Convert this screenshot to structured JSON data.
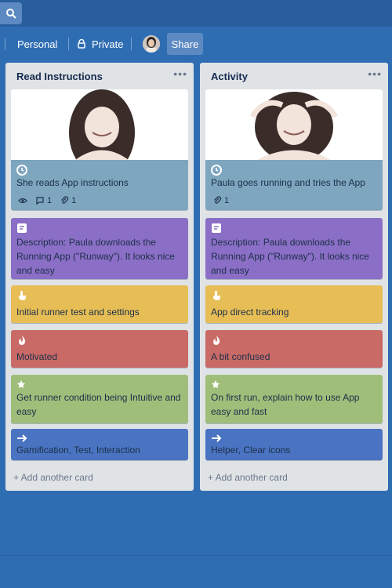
{
  "header": {
    "search_icon": "search-icon"
  },
  "board_bar": {
    "visibility_team_label": "Personal",
    "privacy_label": "Private",
    "share_label": "Share"
  },
  "colors": {
    "background": "#2f6db3",
    "card_blue_gray": "#7ea6bf",
    "card_purple": "#8b6fc7",
    "card_yellow": "#e7be55",
    "card_red": "#c96a66",
    "card_green": "#9fbe7a",
    "card_blue": "#4a74c2"
  },
  "lists": [
    {
      "title": "Read Instructions",
      "cards": [
        {
          "text": "She reads App instructions",
          "icon": "clock-icon",
          "badges": {
            "views": "",
            "comments": "1",
            "attachments": "1"
          }
        },
        {
          "text": "Description: Paula downloads the Running App (\"Runway\"). It looks nice and easy",
          "icon": "description-icon"
        },
        {
          "text": "Initial runner test and settings",
          "icon": "touch-icon"
        },
        {
          "text": "Motivated",
          "icon": "flame-icon"
        },
        {
          "text": "Get runner condition being Intuitive and easy",
          "icon": "star-icon"
        },
        {
          "text": "Gamification, Test, Interaction",
          "icon": "arrow-right-icon"
        }
      ],
      "add_card_label": "+ Add another card"
    },
    {
      "title": "Activity",
      "cards": [
        {
          "text": "Paula goes running and tries the App",
          "icon": "clock-icon",
          "badges": {
            "attachments": "1"
          }
        },
        {
          "text": "Description: Paula downloads the Running App (\"Runway\"). It looks nice and easy",
          "icon": "description-icon"
        },
        {
          "text": "App direct tracking",
          "icon": "touch-icon"
        },
        {
          "text": "A bit confused",
          "icon": "flame-icon"
        },
        {
          "text": "On first run, explain how to use App easy and fast",
          "icon": "star-icon"
        },
        {
          "text": "Helper, Clear icons",
          "icon": "arrow-right-icon"
        }
      ],
      "add_card_label": "+ Add another card"
    }
  ]
}
